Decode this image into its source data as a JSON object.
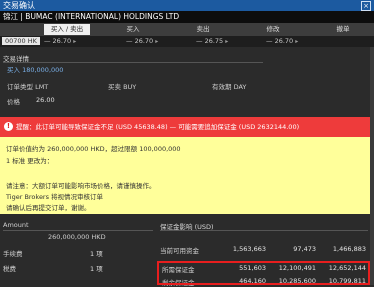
{
  "window": {
    "title": "交易确认",
    "close": "×"
  },
  "account": {
    "name": "锦江 | BUMAC (INTERNATIONAL) HOLDINGS LTD"
  },
  "tabs": [
    {
      "label": "买入 / 卖出"
    },
    {
      "label": "买入"
    },
    {
      "label": "卖出"
    },
    {
      "label": "修改"
    },
    {
      "label": "撤单"
    }
  ],
  "quotes": [
    {
      "symbol": "00700 HK",
      "value": "— 26.70",
      "arrow": "▸"
    },
    {
      "symbol": "",
      "value": "— 26.70",
      "arrow": "▸"
    },
    {
      "symbol": "",
      "value": "— 26.75",
      "arrow": "▸"
    },
    {
      "symbol": "",
      "value": "— 26.70",
      "arrow": "▸"
    }
  ],
  "order": {
    "section_title": "交易详情",
    "amount_text": "买入 180,000,000",
    "order_type_label": "订单类型 LMT",
    "action_label": "买卖 BUY",
    "tif_label": "有效期 DAY",
    "price_label": "价格",
    "price_value": "26.00"
  },
  "warning": {
    "icon": "!",
    "text": "提醒：此订单可能导致保证金不足 (USD 45638.48) — 可能需要追加保证金 (USD 2632144.00)"
  },
  "notice": {
    "lines": [
      "订单价值约为 260,000,000 HKD，超过限额 100,000,000",
      "1 标准  更改为：",
      "",
      "请注意：大额订单可能影响市场价格，请谨慎操作。",
      "Tiger Brokers 将视情况审核订单",
      "请确认后再提交订单，谢谢。"
    ]
  },
  "lower": {
    "amount_label": "Amount",
    "amount_value": "260,000,000 HKD",
    "row2_label": "手续费",
    "row2_value": "1 项",
    "row3_label": "税费",
    "row3_value": "1 项",
    "usd_header": "保证金影响 (USD)",
    "rows": [
      {
        "label": "当前可用资金",
        "a": "1,563,663",
        "b": "97,473",
        "c": "1,466,883"
      },
      {
        "label": "所需保证金",
        "a": "551,603",
        "b": "12,100,491",
        "c": "12,652,144"
      },
      {
        "label": "剩余保证金",
        "a": "464,160",
        "b": "10,285,600",
        "c": "10,799,811"
      }
    ]
  }
}
